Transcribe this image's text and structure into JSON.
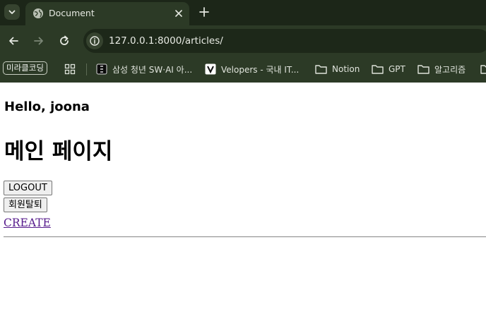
{
  "browser": {
    "tab": {
      "title": "Document"
    },
    "address_bar": {
      "url": "127.0.0.1:8000/articles/"
    },
    "bookmarks": [
      {
        "label": "미라클코딩",
        "icon": "pill"
      },
      {
        "label": "",
        "icon": "apps-grid-icon"
      },
      {
        "label": "삼성 청년 SW·AI 아...",
        "icon": "ssafy-favicon"
      },
      {
        "label": "Velopers - 국내 IT...",
        "icon": "velopers-favicon"
      },
      {
        "label": "Notion",
        "icon": "folder-icon"
      },
      {
        "label": "GPT",
        "icon": "folder-icon"
      },
      {
        "label": "알고리즘",
        "icon": "folder-icon"
      }
    ]
  },
  "page": {
    "greeting": "Hello, joona",
    "heading": "메인 페이지",
    "logout_label": "LOGOUT",
    "withdraw_label": "회원탈퇴",
    "create_label": "CREATE"
  },
  "colors": {
    "chrome_dark": "#1c2618",
    "chrome_toolbar": "#2c3a26",
    "visited_link": "#551a8b"
  }
}
